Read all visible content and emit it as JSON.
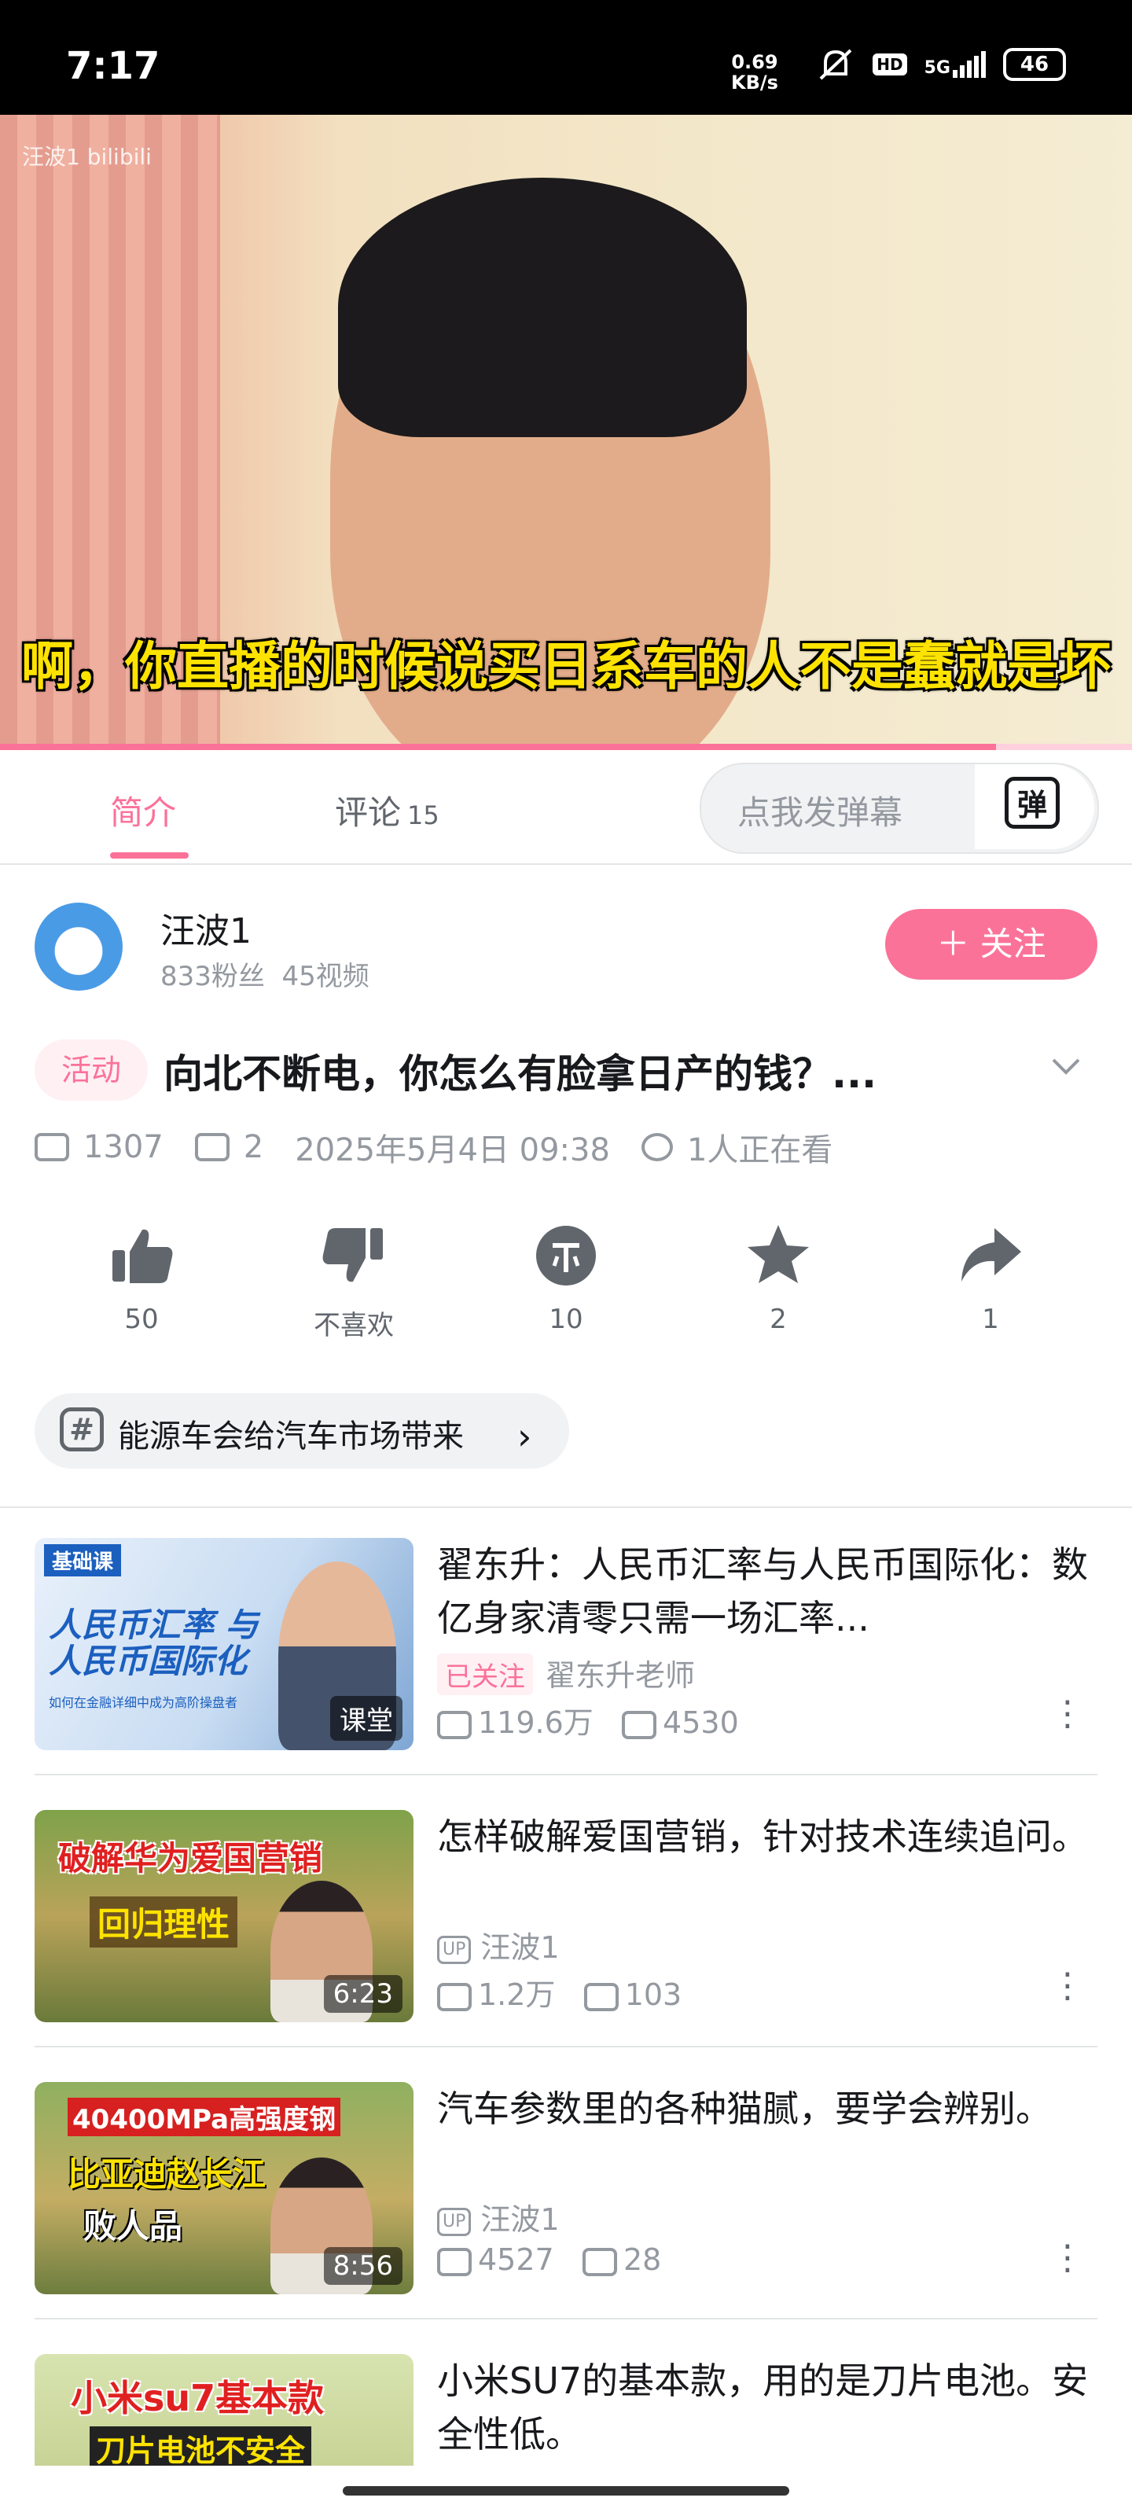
{
  "status_bar": {
    "time": "7:17",
    "net_speed_value": "0.69",
    "net_speed_unit": "KB/s",
    "hd": "HD",
    "signal": "5G",
    "battery": "46"
  },
  "player": {
    "watermark": "汪波1 bilibili",
    "subtitle": "啊，你直播的时候说买日系车的人不是蠢就是坏",
    "progress": 0.88
  },
  "tabs": {
    "intro": "简介",
    "comments": "评论",
    "comments_count": "15",
    "danmaku_placeholder": "点我发弹幕",
    "danmaku_icon": "弹"
  },
  "uploader": {
    "name": "汪波1",
    "fans": "833粉丝",
    "videos": "45视频",
    "follow_label": "＋ 关注"
  },
  "video": {
    "tag": "活动",
    "title": "向北不断电，你怎么有脸拿日产的钱？...",
    "views": "1307",
    "danmaku_count": "2",
    "date": "2025年5月4日 09:38",
    "watching": "1人正在看"
  },
  "actions": [
    {
      "icon": "thumbs-up-icon",
      "label": "50"
    },
    {
      "icon": "thumbs-down-icon",
      "label": "不喜欢"
    },
    {
      "icon": "coin-icon",
      "label": "10"
    },
    {
      "icon": "star-icon",
      "label": "2"
    },
    {
      "icon": "share-icon",
      "label": "1"
    }
  ],
  "topic": {
    "text": "能源车会给汽车市场带来"
  },
  "recommendations": [
    {
      "title": "翟东升：人民币汇率与人民币国际化：数亿身家清零只需一场汇率...",
      "badge": "已关注",
      "author": "翟东升老师",
      "views": "119.6万",
      "danmaku": "4530",
      "duration": "课堂",
      "thumb_top": "基础课",
      "thumb_main": "人民币汇率 与人民币国际化",
      "thumb_sub": "如何在金融详细中成为高阶操盘者"
    },
    {
      "title": "怎样破解爱国营销，针对技术连续追问。",
      "badge": "UP",
      "author": "汪波1",
      "views": "1.2万",
      "danmaku": "103",
      "duration": "6:23",
      "thumb_top": "破解华为爱国营销",
      "thumb_main": "回归理性",
      "thumb_sub": ""
    },
    {
      "title": "汽车参数里的各种猫腻，要学会辨别。",
      "badge": "UP",
      "author": "汪波1",
      "views": "4527",
      "danmaku": "28",
      "duration": "8:56",
      "thumb_top": "40400MPa高强度钢",
      "thumb_main": "比亚迪赵长江",
      "thumb_sub": "败人品"
    },
    {
      "title": "小米SU7的基本款，用的是刀片电池。安全性低。",
      "thumb_top": "小米su7基本款",
      "thumb_main": "刀片电池不安全"
    }
  ],
  "colors": {
    "accent": "#fb7299",
    "text": "#18191c",
    "secondary": "#9499a0"
  }
}
